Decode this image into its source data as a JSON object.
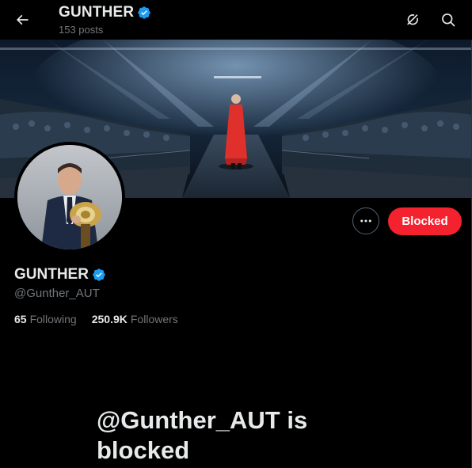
{
  "header": {
    "title": "GUNTHER",
    "post_count": "153 posts",
    "back_icon": "back-arrow-icon",
    "grok_icon": "grok-icon",
    "search_icon": "search-icon"
  },
  "profile": {
    "name": "GUNTHER",
    "handle": "@Gunther_AUT",
    "verified_color": "#1d9bf0",
    "following_count": "65",
    "following_label": "Following",
    "followers_count": "250.9K",
    "followers_label": "Followers"
  },
  "actions": {
    "more_icon": "more-icon",
    "blocked_label": "Blocked",
    "blocked_color": "#f4212e"
  },
  "blocked_notice": {
    "message": "@Gunther_AUT is blocked"
  },
  "colors": {
    "background": "#000000",
    "text_primary": "#e7e9ea",
    "text_secondary": "#71767b",
    "accent": "#1d9bf0"
  }
}
